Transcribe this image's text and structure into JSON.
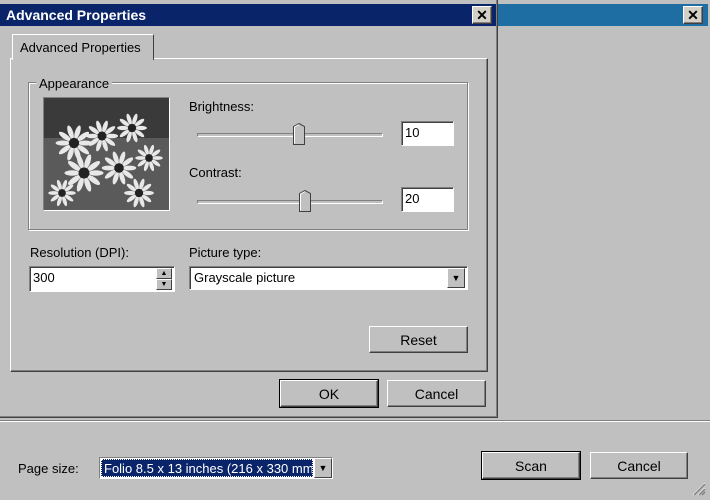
{
  "dialog": {
    "title": "Advanced Properties",
    "close_label": "✕",
    "tab_label": "Advanced Properties",
    "appearance": {
      "group_label": "Appearance",
      "brightness_label": "Brightness:",
      "brightness_value": "10",
      "brightness_level": 0.55,
      "contrast_label": "Contrast:",
      "contrast_value": "20",
      "contrast_level": 0.58,
      "preview_icon": "flowers-photo"
    },
    "resolution_label": "Resolution (DPI):",
    "resolution_value": "300",
    "picture_type_label": "Picture type:",
    "picture_type_value": "Grayscale picture",
    "reset_label": "Reset",
    "ok_label": "OK",
    "cancel_label": "Cancel"
  },
  "main": {
    "close_label": "✕",
    "page_size_label": "Page size:",
    "page_size_value": "Folio 8.5 x 13 inches (216 x 330 mm)",
    "scan_label": "Scan",
    "cancel_label": "Cancel"
  },
  "colors": {
    "dialog_titlebar": "#0a246a",
    "bg_titlebar": "#1e6ea3",
    "face": "#c0c0c0",
    "selection": "#0a246a"
  }
}
